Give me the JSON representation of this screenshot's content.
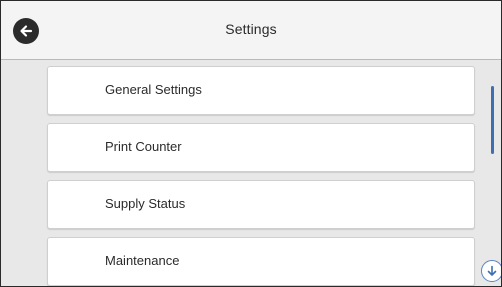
{
  "header": {
    "title": "Settings",
    "back_icon": "back-arrow-icon"
  },
  "menu": {
    "items": [
      {
        "label": "General Settings"
      },
      {
        "label": "Print Counter"
      },
      {
        "label": "Supply Status"
      },
      {
        "label": "Maintenance"
      }
    ]
  },
  "scroll": {
    "down_icon": "scroll-down-arrow-icon"
  },
  "colors": {
    "header_bg": "#f4f4f4",
    "content_bg": "#e8e8e8",
    "item_bg": "#ffffff",
    "accent": "#3e6fb0",
    "back_button": "#2b2b2b"
  }
}
